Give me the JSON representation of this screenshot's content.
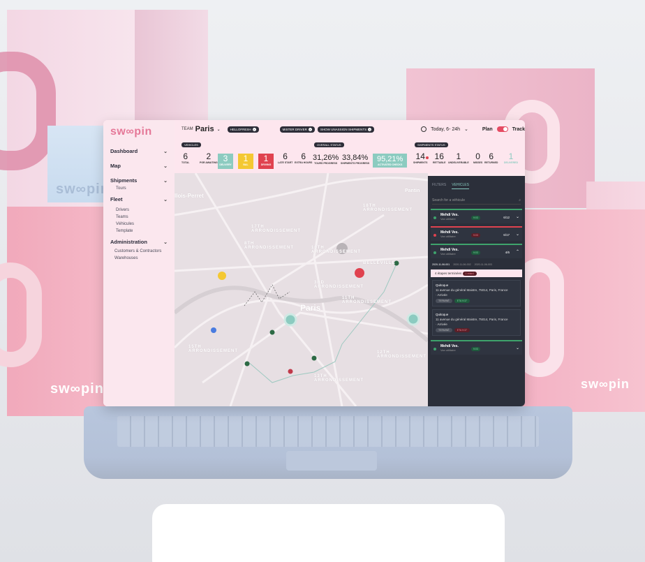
{
  "colors": {
    "accent": "#e57898",
    "teal": "#8ccbc0",
    "red": "#e0424f",
    "yellow": "#f4c832",
    "green": "#3ea36c",
    "panel": "#2b2f3a"
  },
  "brand": {
    "box_mark": "sw∞pin"
  },
  "sidebar": {
    "logo": "sw∞pin",
    "groups": [
      {
        "label": "Dashboard",
        "icon": "chevron-down-icon"
      },
      {
        "label": "Map",
        "icon": "chevron-down-icon"
      },
      {
        "label": "Shipments",
        "icon": "chevron-down-icon"
      },
      {
        "label": "Fleet",
        "icon": "chevron-down-icon"
      },
      {
        "label": "Administration",
        "icon": "chevron-down-icon"
      }
    ],
    "shipments_items": [
      "Tours"
    ],
    "fleet_items": [
      "Drivers",
      "Teams",
      "Véhicules",
      "Template"
    ],
    "admin_items": [
      "Customers & Contractors",
      "Warehouses"
    ]
  },
  "topbar": {
    "team_label": "TEAM",
    "city": "Paris",
    "filters": [
      "HELLOFRESH",
      "MISTER DRIVER",
      "SHOW UNASSIGN SHIPMENTS"
    ],
    "date_label": "Today, 6- 24h",
    "plan_label": "Plan",
    "track_label": "Track"
  },
  "stats": {
    "vehicles_tag": "VEHICLES",
    "overall_tag": "OVERALL STATUS",
    "shipments_tag": "SHIPMENTS STATUS",
    "vehicles": [
      {
        "value": "6",
        "label": "TOTAL"
      },
      {
        "value": "2",
        "label": "PGR AWAITING"
      },
      {
        "value": "3",
        "label": "DELIVERY"
      },
      {
        "value": "1",
        "label": "BAL"
      },
      {
        "value": "1",
        "label": "DRIVING"
      },
      {
        "value": "6",
        "label": "LATE START"
      },
      {
        "value": "6",
        "label": "EXTRA HOURS"
      }
    ],
    "overall": [
      {
        "value": "31,26%",
        "label": "TOURS PROGRESS"
      },
      {
        "value": "33,84%",
        "label": "SHIPMENTS PROGRESS"
      },
      {
        "value": "95,21%",
        "label": "ACTIVATED CHECKS"
      }
    ],
    "shipments": [
      {
        "value": "14",
        "label": "SHIPMENTS"
      },
      {
        "value": "16",
        "label": "RETTABLE"
      },
      {
        "value": "1",
        "label": "UNDELIVERABLE"
      },
      {
        "value": "0",
        "label": "MISSES"
      },
      {
        "value": "6",
        "label": "RETURNED"
      },
      {
        "value": "1",
        "label": "DELIVERED"
      }
    ]
  },
  "map": {
    "labels": [
      "llois-Perret",
      "17TH ARRONDISSEMENT",
      "18TH ARRONDISSEMENT",
      "8TH ARRONDISSEMENT",
      "10TH ARRONDISSEMENT",
      "BELLEVILLE",
      "3RD ARRONDISSEMENT",
      "Paris",
      "11TH ARRONDISSEMENT",
      "15TH ARRONDISSEMENT",
      "12TH ARRONDISSEMENT",
      "13TH ARRONDISSEMENT",
      "Pantin"
    ]
  },
  "panel": {
    "tabs": [
      "FILTERS",
      "VEHICLES"
    ],
    "search_placeholder": "Search for a véhicule",
    "vehicles": [
      {
        "name": "Mehdi Ves.",
        "type": "Van utilitaire",
        "time": "9:03",
        "count": "6/12"
      },
      {
        "name": "Mehdi Ves.",
        "type": "Van utilitaire",
        "time": "9:03",
        "count": "6/17"
      },
      {
        "name": "Mehdi Ves.",
        "type": "Van utilitaire",
        "time": "9:03",
        "count": "4/6"
      },
      {
        "name": "Mehdi Ves.",
        "type": "Van utilitaire",
        "time": "9:03",
        "count": ""
      }
    ],
    "dates": [
      "2020-11-06-001",
      "2020-11-06-002",
      "2020-11-06-003"
    ],
    "steps_text": "4 étapes terminées",
    "steps_badge": "1 retard",
    "cards": [
      {
        "title": "Quitoque",
        "address": "11 avenue du général Maistre, 75014, Paris, France",
        "note": "· Arrivée",
        "chip1": "TERMINÉ",
        "chip2": "ETA 9:37"
      },
      {
        "title": "Quitoque",
        "address": "11 avenue du général Maistre, 75014, Paris, France",
        "note": "· Arrivée",
        "chip1": "TERMINÉ",
        "chip2": "ETA 9:37"
      }
    ]
  }
}
